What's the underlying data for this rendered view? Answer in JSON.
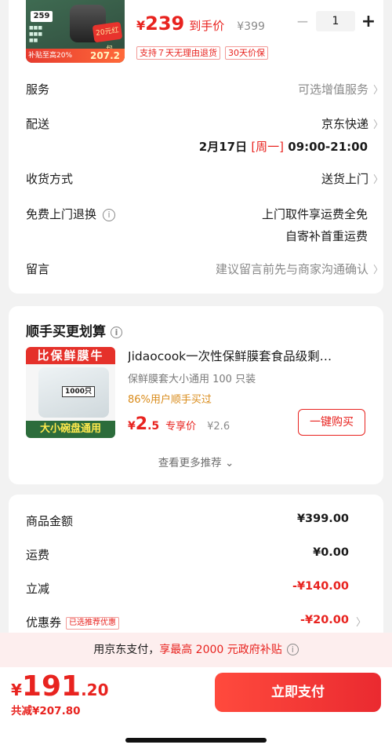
{
  "product": {
    "thumb_badge": "259",
    "thumb_tag": "20元红包",
    "thumb_strip_left": "补贴至高20%",
    "thumb_strip_value": "207.2",
    "currency": "¥",
    "price": "239",
    "price_tag": "到手价",
    "original_price": "¥399",
    "quantity": "1",
    "minus": "−",
    "plus": "+",
    "badges": [
      "支持７天无理由退货",
      "30天价保"
    ]
  },
  "options": {
    "service": {
      "label": "服务",
      "value": "可选增值服务"
    },
    "delivery": {
      "label": "配送",
      "value": "京东快递",
      "date": "2月17日",
      "weekday": "[周一]",
      "time": "09:00-21:00"
    },
    "receive": {
      "label": "收货方式",
      "value": "送货上门"
    },
    "return": {
      "label": "免费上门退换",
      "line1": "上门取件享运费全免",
      "line2": "自寄补首重运费"
    },
    "message": {
      "label": "留言",
      "value": "建议留言前先与商家沟通确认"
    }
  },
  "recommend": {
    "header": "顺手买更划算",
    "img_top": "比保鲜膜牛",
    "img_count": "1000只",
    "img_bottom": "大小碗盘通用",
    "title": "Jidaocook一次性保鲜膜套食品级剩…",
    "subtitle": "保鲜膜套大小通用 100 只装",
    "bought": "86%用户顺手买过",
    "currency": "¥",
    "price_int": "2",
    "price_dec": ".5",
    "price_tag": "专享价",
    "original_price": "¥2.6",
    "buy_label": "一键购买",
    "more_label": "查看更多推荐"
  },
  "totals": {
    "goods": {
      "label": "商品金额",
      "value": "¥399.00"
    },
    "shipping": {
      "label": "运费",
      "value": "¥0.00"
    },
    "discount": {
      "label": "立减",
      "value": "-¥140.00"
    },
    "coupon": {
      "label": "优惠券",
      "tag": "已选推荐优惠",
      "value": "-¥20.00"
    }
  },
  "banner": {
    "prefix": "用京东支付，",
    "highlight": "享最高 2000 元政府补贴"
  },
  "bottom": {
    "currency": "¥",
    "total_int": "191",
    "total_dec": ".20",
    "saved": "共减¥207.80",
    "pay_label": "立即支付"
  },
  "colors": {
    "accent_red": "#e8231f",
    "bought_orange": "#d98b1a"
  }
}
